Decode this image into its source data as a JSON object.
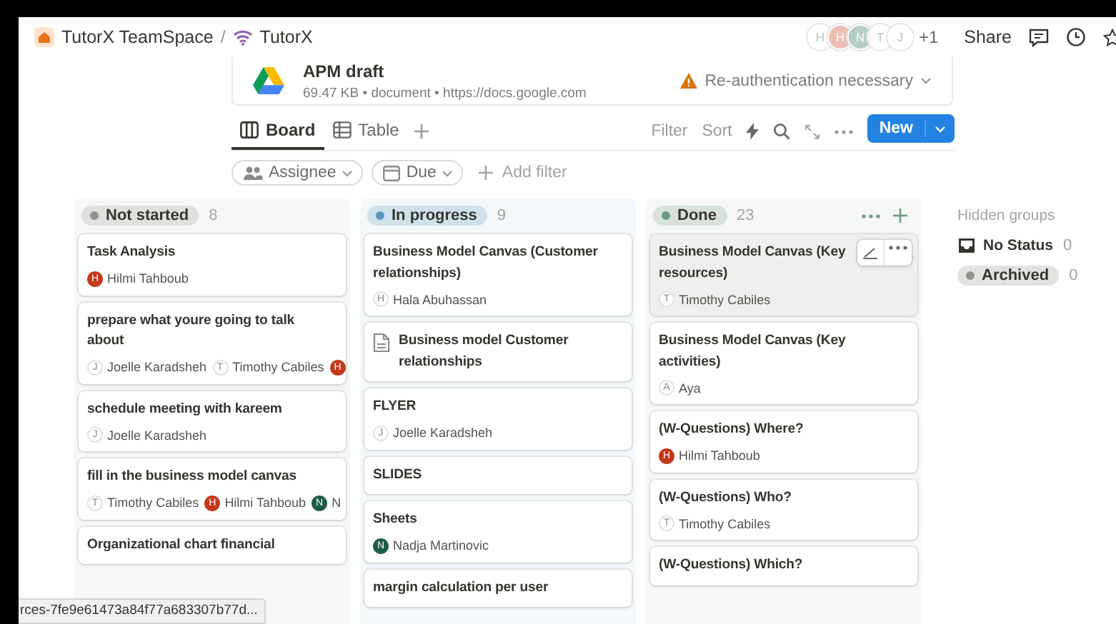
{
  "breadcrumb": [
    {
      "label": "TutorX TeamSpace"
    },
    {
      "label": "TutorX"
    }
  ],
  "breadcrumb_separator": "/",
  "collaborators": [
    {
      "initial": "H",
      "color": "#ffffff"
    },
    {
      "initial": "H",
      "color": "#e8b4a6"
    },
    {
      "initial": "N",
      "color": "#a9c7bd"
    },
    {
      "initial": "T",
      "color": "#ffffff"
    },
    {
      "initial": "J",
      "color": "#ffffff"
    }
  ],
  "collaborators_more": "+1",
  "header_actions": {
    "share": "Share"
  },
  "file": {
    "name": "APM draft",
    "meta": "69.47 KB • document • https://docs.google.com",
    "warning": "Re-authentication necessary"
  },
  "views": [
    {
      "label": "Board",
      "selected": true
    },
    {
      "label": "Table",
      "selected": false
    }
  ],
  "toolbar": {
    "filter": "Filter",
    "sort": "Sort",
    "new": "New"
  },
  "filters": [
    {
      "label": "Assignee"
    },
    {
      "label": "Due"
    }
  ],
  "add_filter": "Add filter",
  "groups": [
    {
      "name": "Not started",
      "count": "8",
      "color": "#91918e",
      "show_actions": false,
      "cards": [
        {
          "kind": "task",
          "title": "Task Analysis",
          "hovered": false,
          "people": [
            {
              "initial": "H",
              "name": "Hilmi Tahboub",
              "color": "#c4381a"
            }
          ]
        },
        {
          "kind": "task",
          "title": "prepare what youre going to talk about",
          "hovered": false,
          "people": [
            {
              "initial": "J",
              "name": "Joelle Karadsheh"
            },
            {
              "initial": "T",
              "name": "Timothy Cabiles"
            },
            {
              "initial": "H",
              "color": "#c4381a"
            }
          ]
        },
        {
          "kind": "task",
          "title": "schedule meeting with kareem",
          "hovered": false,
          "people": [
            {
              "initial": "J",
              "name": "Joelle Karadsheh"
            }
          ]
        },
        {
          "kind": "task",
          "title": "fill in the business model canvas",
          "hovered": false,
          "people": [
            {
              "initial": "T",
              "name": "Timothy Cabiles"
            },
            {
              "initial": "H",
              "name": "Hilmi Tahboub",
              "color": "#c4381a"
            },
            {
              "initial": "N",
              "name": "N",
              "color": "#1e5b45"
            }
          ]
        },
        {
          "kind": "task",
          "title": "Organizational chart financial",
          "hovered": false
        }
      ]
    },
    {
      "name": "In progress",
      "count": "9",
      "color": "#5b97bd",
      "show_actions": false,
      "cards": [
        {
          "kind": "task",
          "title": "Business Model Canvas (Customer relationships)",
          "hovered": false,
          "people": [
            {
              "initial": "H",
              "name": "Hala Abuhassan"
            }
          ]
        },
        {
          "kind": "page",
          "title": "Business model Customer relationships",
          "hovered": false
        },
        {
          "kind": "task",
          "title": "FLYER",
          "hovered": false,
          "people": [
            {
              "initial": "J",
              "name": "Joelle Karadsheh"
            }
          ]
        },
        {
          "kind": "task",
          "title": "SLIDES",
          "hovered": false
        },
        {
          "kind": "task",
          "title": "Sheets",
          "hovered": false,
          "people": [
            {
              "initial": "N",
              "name": "Nadja Martinovic",
              "color": "#1e5b45"
            }
          ]
        },
        {
          "kind": "task",
          "title": "margin calculation per user",
          "hovered": false
        }
      ]
    },
    {
      "name": "Done",
      "count": "23",
      "color": "#6c9b7d",
      "show_actions": true,
      "cards": [
        {
          "kind": "task",
          "title": "Business Model Canvas (Key resources)",
          "hovered": true,
          "people": [
            {
              "initial": "T",
              "name": "Timothy Cabiles"
            }
          ]
        },
        {
          "kind": "task",
          "title": "Business Model Canvas (Key activities)",
          "hovered": false,
          "people": [
            {
              "initial": "A",
              "name": "Aya"
            }
          ]
        },
        {
          "kind": "task",
          "title": "(W-Questions) Where?",
          "hovered": false,
          "people": [
            {
              "initial": "H",
              "name": "Hilmi Tahboub",
              "color": "#c4381a"
            }
          ]
        },
        {
          "kind": "task",
          "title": "(W-Questions) Who?",
          "hovered": false,
          "people": [
            {
              "initial": "T",
              "name": "Timothy Cabiles"
            }
          ]
        },
        {
          "kind": "task",
          "title": "(W-Questions) Which?",
          "hovered": false
        }
      ]
    }
  ],
  "hidden_groups": {
    "title": "Hidden groups",
    "items": [
      {
        "kind": "inbox",
        "label": "No Status",
        "count": "0"
      },
      {
        "kind": "pill",
        "label": "Archived",
        "count": "0"
      }
    ]
  },
  "status_url": "rces-7fe9e61473a84f77a683307b77d..."
}
